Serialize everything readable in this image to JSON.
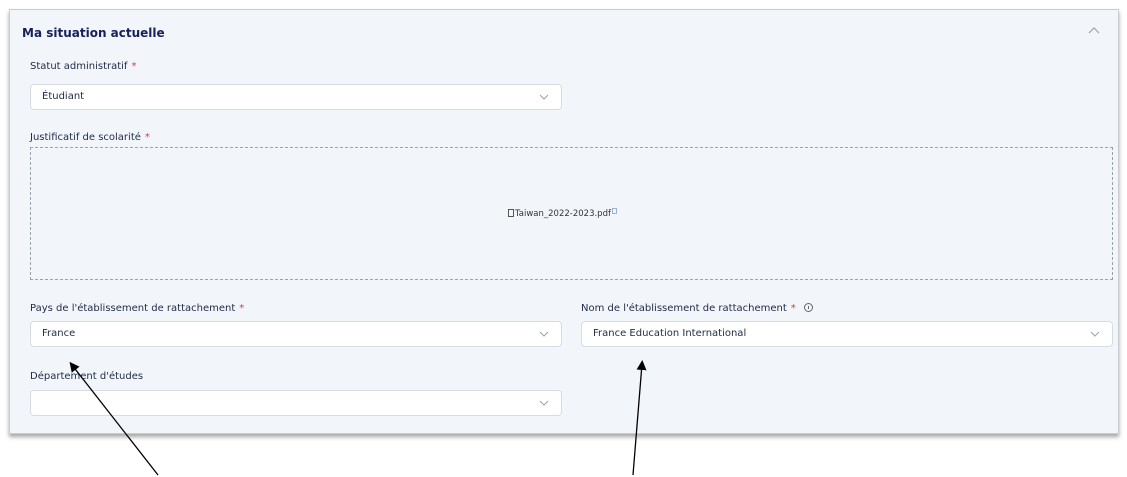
{
  "section": {
    "title": "Ma situation actuelle",
    "collapse_icon": "chevron-up-icon"
  },
  "statut": {
    "label": "Statut administratif",
    "required": "*",
    "value": "Étudiant"
  },
  "justificatif": {
    "label": "Justificatif de scolarité",
    "required": "*",
    "file_name": "Taiwan_2022-2023.pdf",
    "file_icon": "document-icon",
    "remove_icon": "delete-icon"
  },
  "pays": {
    "label": "Pays de l'établissement de rattachement",
    "required": "*",
    "value": "France"
  },
  "nom": {
    "label": "Nom de l'établissement de rattachement",
    "required": "*",
    "info_icon": "info-icon",
    "value": "France Education International"
  },
  "departement": {
    "label": "Département d'études",
    "value": ""
  },
  "annotations": {
    "arrow_color": "#000000"
  },
  "colors": {
    "panel_bg": "#f2f6fb",
    "required": "#e0324f",
    "title": "#16215a"
  }
}
